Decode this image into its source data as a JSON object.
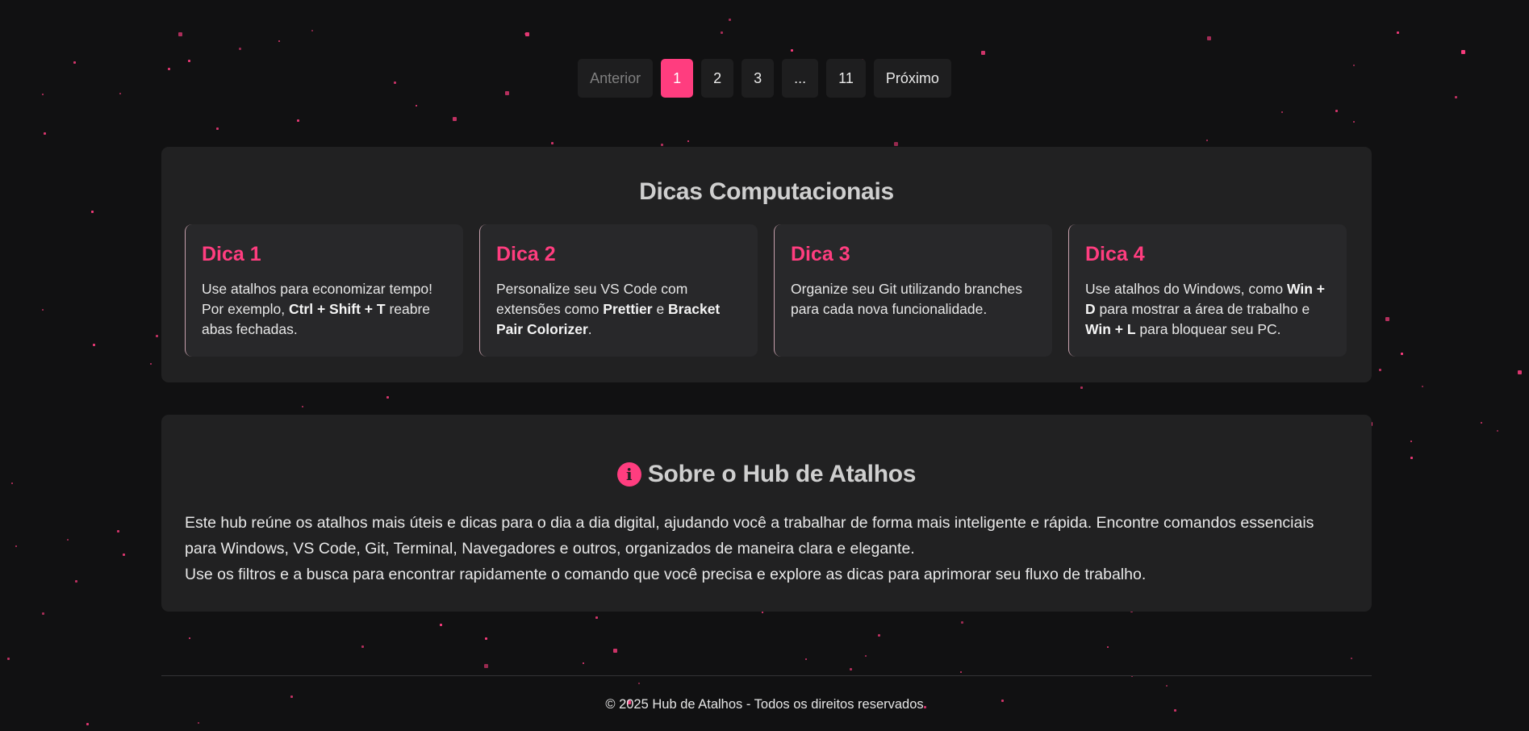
{
  "pagination": {
    "previous_label": "Anterior",
    "pages": [
      "1",
      "2",
      "3",
      "...",
      "11"
    ],
    "current_page": "1",
    "next_label": "Próximo"
  },
  "tips": {
    "title": "Dicas Computacionais",
    "cards": [
      {
        "title": "Dica 1",
        "parts": [
          {
            "t": "Use atalhos para economizar tempo! Por exemplo, "
          },
          {
            "t": "Ctrl + Shift + T",
            "b": true
          },
          {
            "t": " reabre abas fechadas."
          }
        ]
      },
      {
        "title": "Dica 2",
        "parts": [
          {
            "t": "Personalize seu VS Code com extensões como "
          },
          {
            "t": "Prettier",
            "b": true
          },
          {
            "t": " e "
          },
          {
            "t": "Bracket Pair Colorizer",
            "b": true
          },
          {
            "t": "."
          }
        ]
      },
      {
        "title": "Dica 3",
        "parts": [
          {
            "t": "Organize seu Git utilizando branches para cada nova funcionalidade."
          }
        ]
      },
      {
        "title": "Dica 4",
        "parts": [
          {
            "t": "Use atalhos do Windows, como "
          },
          {
            "t": "Win + D",
            "b": true
          },
          {
            "t": " para mostrar a área de trabalho e "
          },
          {
            "t": "Win + L",
            "b": true
          },
          {
            "t": " para bloquear seu PC."
          }
        ]
      }
    ]
  },
  "about": {
    "icon": "info-circle-icon",
    "title": "Sobre o Hub de Atalhos",
    "paragraph1": "Este hub reúne os atalhos mais úteis e dicas para o dia a dia digital, ajudando você a trabalhar de forma mais inteligente e rápida. Encontre comandos essenciais para Windows, VS Code, Git, Terminal, Navegadores e outros, organizados de maneira clara e elegante.",
    "paragraph2": "Use os filtros e a busca para encontrar rapidamente o comando que você precisa e explore as dicas para aprimorar seu fluxo de trabalho."
  },
  "footer": {
    "text": "© 2025 Hub de Atalhos - Todos os direitos reservados"
  },
  "colors": {
    "accent": "#ff3d7f",
    "background": "#111112",
    "panel": "#212122",
    "card": "#28282a"
  }
}
